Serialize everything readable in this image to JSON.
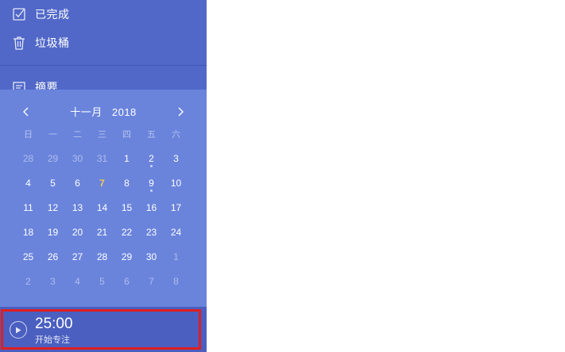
{
  "sidebar": {
    "items": [
      {
        "label": "已完成",
        "icon": "checkbox-icon"
      },
      {
        "label": "垃圾桶",
        "icon": "trash-icon"
      },
      {
        "label": "摘要",
        "icon": "summary-icon"
      }
    ]
  },
  "calendar": {
    "month": "十一月",
    "year": "2018",
    "weekdays": [
      "日",
      "一",
      "二",
      "三",
      "四",
      "五",
      "六"
    ],
    "weeks": [
      [
        {
          "d": "28",
          "m": true
        },
        {
          "d": "29",
          "m": true
        },
        {
          "d": "30",
          "m": true
        },
        {
          "d": "31",
          "m": true
        },
        {
          "d": "1"
        },
        {
          "d": "2",
          "dot": true
        },
        {
          "d": "3"
        }
      ],
      [
        {
          "d": "4"
        },
        {
          "d": "5"
        },
        {
          "d": "6"
        },
        {
          "d": "7",
          "today": true
        },
        {
          "d": "8"
        },
        {
          "d": "9",
          "dot": true
        },
        {
          "d": "10"
        }
      ],
      [
        {
          "d": "11"
        },
        {
          "d": "12"
        },
        {
          "d": "13"
        },
        {
          "d": "14"
        },
        {
          "d": "15"
        },
        {
          "d": "16"
        },
        {
          "d": "17"
        }
      ],
      [
        {
          "d": "18"
        },
        {
          "d": "19"
        },
        {
          "d": "20"
        },
        {
          "d": "21"
        },
        {
          "d": "22"
        },
        {
          "d": "23"
        },
        {
          "d": "24"
        }
      ],
      [
        {
          "d": "25"
        },
        {
          "d": "26"
        },
        {
          "d": "27"
        },
        {
          "d": "28"
        },
        {
          "d": "29"
        },
        {
          "d": "30"
        },
        {
          "d": "1",
          "m": true
        }
      ],
      [
        {
          "d": "2",
          "m": true
        },
        {
          "d": "3",
          "m": true
        },
        {
          "d": "4",
          "m": true
        },
        {
          "d": "5",
          "m": true
        },
        {
          "d": "6",
          "m": true
        },
        {
          "d": "7",
          "m": true
        },
        {
          "d": "8",
          "m": true
        }
      ]
    ],
    "today_color": "#f2c94c"
  },
  "pomodoro": {
    "time": "25:00",
    "label": "开始专注",
    "highlight_color": "#e01e1e"
  },
  "colors": {
    "sidebar": "#5168c8",
    "calendar": "#6a84dc",
    "pomodoro": "#4a5fc0"
  }
}
